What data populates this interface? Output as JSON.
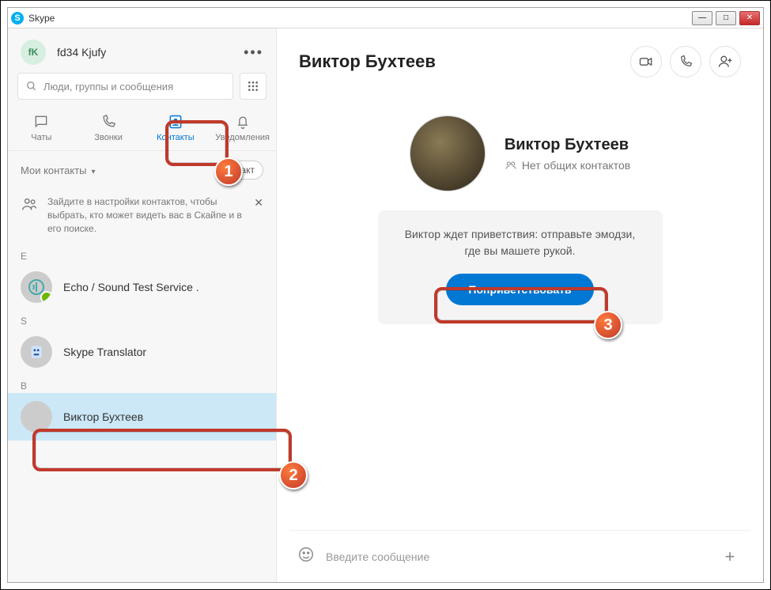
{
  "window": {
    "title": "Skype"
  },
  "sidebar": {
    "profile": {
      "initials": "fK",
      "name": "fd34 Kjufy"
    },
    "search_placeholder": "Люди, группы и сообщения",
    "tabs": {
      "chats": "Чаты",
      "calls": "Звонки",
      "contacts": "Контакты",
      "notifications": "Уведомления"
    },
    "subheader": {
      "label": "Мои контакты",
      "button_suffix": "акт"
    },
    "tip": "Зайдите в настройки контактов, чтобы выбрать, кто может видеть вас в Скайпе и в его поиске.",
    "sections": {
      "e": "E",
      "s": "S",
      "v": "В"
    },
    "contacts": {
      "echo": "Echo / Sound Test Service .",
      "translator": "Skype Translator",
      "viktor": "Виктор Бухтеев"
    }
  },
  "main": {
    "title": "Виктор Бухтеев",
    "profile": {
      "name": "Виктор Бухтеев",
      "subtitle": "Нет общих контактов"
    },
    "card": {
      "text": "Виктор ждет приветствия: отправьте эмодзи, где вы машете рукой.",
      "button": "Поприветствовать"
    },
    "composer_placeholder": "Введите сообщение"
  },
  "annotations": {
    "n1": "1",
    "n2": "2",
    "n3": "3"
  }
}
